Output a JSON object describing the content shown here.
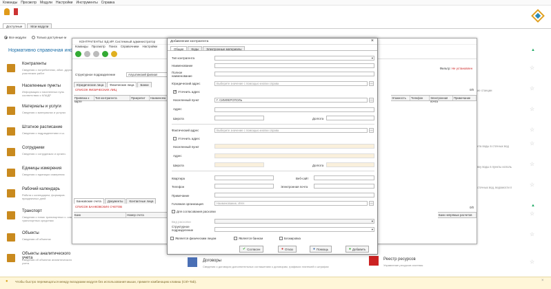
{
  "menubar": [
    "Команды",
    "Просмотр",
    "Модули",
    "Настройки",
    "Инструменты",
    "Справка"
  ],
  "tabs": [
    "Доступные",
    "Мои модули"
  ],
  "radios": {
    "all": "Все модули",
    "only": "Только доступные м"
  },
  "section_title": "Нормативно справочная инфо",
  "modules": [
    {
      "title": "Контрагенты",
      "desc": "Сведения о потребителях, абон. других участниках работ"
    },
    {
      "title": "Населенные пункты",
      "desc": "Информация о населенных пунк. соответствии с КЛАДР"
    },
    {
      "title": "Материалы и услуги",
      "desc": "Сведения о материалах и услугах"
    },
    {
      "title": "Штатное расписание",
      "desc": "Сведения о подразделениях и ш."
    },
    {
      "title": "Сотрудники",
      "desc": "Сведения о сотрудниках и органи."
    },
    {
      "title": "Единицы измерения",
      "desc": "Сведения о единицах измерения"
    },
    {
      "title": "Рабочий календарь",
      "desc": "Работа с календарем, формиров. праздничных дней"
    },
    {
      "title": "Транспорт",
      "desc": "Сведения о типах транспортных с. самих транспортных средствах"
    },
    {
      "title": "Объекты",
      "desc": "Сведения об объектах"
    },
    {
      "title": "Объекты аналитического учета",
      "desc": "Сведения об объектах аналитического учета"
    }
  ],
  "right_snippets": [
    "ие станции",
    "ета воды в сточных вод",
    "вку воды в пункты исполь",
    "сточных вод, ведомости п"
  ],
  "bottom_right": {
    "contracts_title": "Договоры",
    "contracts_desc": "Сведения о договорах дополнительных соглашениях к договорам, графиках платежей и штрафах",
    "registry_title": "Реестр ресурсов",
    "registry_desc": "Управление ресурсов системы"
  },
  "bottom_bar": "Чтобы быстро перемещаться между вкладками модуля без использования мыши, примите комбинацию клавиш (Ctrl+Tab).",
  "bgwin": {
    "title": "КОНТРАГЕНТЫ: БД ИР, Системный администратор",
    "menu": [
      "Команды",
      "Просмотр",
      "Поиск",
      "Справочники",
      "Настройки"
    ],
    "filter_label": "Фильтр:",
    "filter_value": "Не установлен",
    "struct_label": "Структурное подразделение",
    "struct_value": "Алуштинский филиал",
    "subtabs": [
      "Юридические лица",
      "Физические лица",
      "Банки"
    ],
    "list1": "СПИСОК ФИЗИЧЕСКИХ ЛИЦ",
    "cols1": [
      "Привязка к карте",
      "Тип контрагента",
      "Прикрепит",
      "Наименова"
    ],
    "cols1r": [
      "Этажность",
      "Телефон",
      "Электронная почта",
      "Примечание"
    ],
    "count1": "0/0",
    "subtabs2": [
      "Банковские счета",
      "Документы",
      "Контактные лица"
    ],
    "list2": "СПИСОК БАНКОВСКИХ СЧЕТОВ",
    "cols2": [
      "Банк",
      "Номер счета"
    ],
    "cols2r": [
      "Банк непрямых расчетов"
    ],
    "count2": "0/0"
  },
  "dialog": {
    "title": "Добавление контрагента",
    "tabs": [
      "Общие",
      "Коды",
      "Электронные материалы"
    ],
    "type_label": "Тип контрагента",
    "name_label": "Наименование",
    "fullname_label": "Полное наименование",
    "legal_addr_label": "Юридический адрес",
    "legal_addr_placeholder": "Выберите значение с помощью кнопки справа",
    "refine1": "Уточнить адрес",
    "locality_label": "Населенный пункт",
    "locality_value": "Г. СИМФЕРОПОЛЬ",
    "address_label": "Адрес",
    "lat_label": "Широта",
    "lon_label": "Долгота",
    "phys_addr_label": "Фактический адрес",
    "phys_addr_placeholder": "Выберите значение с помощью кнопки справа",
    "refine2": "Уточнить адрес",
    "locality2_label": "Населенный пункт",
    "address2_label": "Адрес",
    "lat2_label": "Широта",
    "lon2_label": "Долгота",
    "apt_label": "Квартира",
    "web_label": "Веб-сайт",
    "phone_label": "Телефон",
    "email_label": "Электронная почта",
    "note_label": "Примечание",
    "head_org_label": "Головная организация",
    "head_org_placeholder": "Наименование, ИНН",
    "agree_label": "Для согласования расхолки",
    "type_calc_label": "Вид расхолки",
    "struct_label": "Структурное подразделение",
    "chk_phys": "Является физическим лицом",
    "chk_bank": "Является банком",
    "chk_block": "Блокировка",
    "btn_ok": "Согласен",
    "btn_cancel": "Отказ",
    "btn_help": "Помощь",
    "btn_add": "Добавить"
  },
  "colors": {
    "accent": "#1b6ea8",
    "module_icon": "#c98a1e",
    "bottom_bar": "#fff6d8"
  }
}
